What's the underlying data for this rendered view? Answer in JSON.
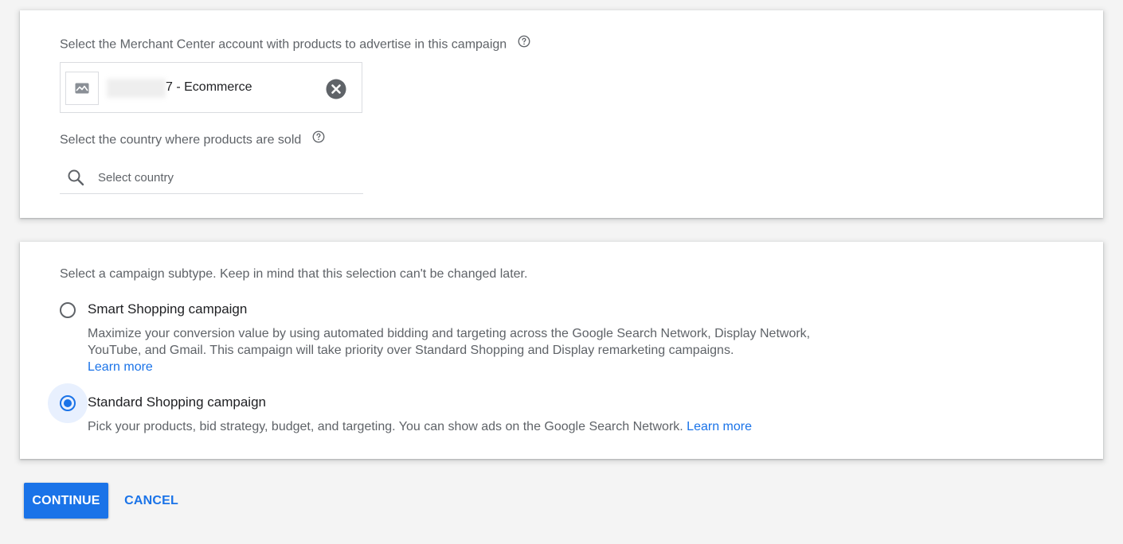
{
  "account_section": {
    "label": "Select the Merchant Center account with products to advertise in this campaign",
    "help_icon": "help-circle-icon",
    "selected_account": {
      "name": "7 - Ecommerce",
      "thumbnail_icon": "image-placeholder-icon",
      "clear_icon": "clear-circle-icon"
    },
    "country_label": "Select the country where products are sold",
    "country_help_icon": "help-circle-icon",
    "country_placeholder": "Select country",
    "country_value": "",
    "search_icon": "search-icon"
  },
  "subtype_section": {
    "label": "Select a campaign subtype. Keep in mind that this selection can't be changed later.",
    "options": [
      {
        "title": "Smart Shopping campaign",
        "description": "Maximize your conversion value by using automated bidding and targeting across the Google Search Network, Display Network, YouTube, and Gmail. This campaign will take priority over Standard Shopping and Display remarketing campaigns.",
        "link": "Learn more",
        "selected": false
      },
      {
        "title": "Standard Shopping campaign",
        "description": "Pick your products, bid strategy, budget, and targeting. You can show ads on the Google Search Network.",
        "link": "Learn more",
        "selected": true
      }
    ]
  },
  "actions": {
    "continue_label": "CONTINUE",
    "cancel_label": "CANCEL"
  },
  "colors": {
    "accent": "#1a73e8",
    "text_primary": "#202124",
    "text_secondary": "#5f6368",
    "background": "#f4f4f4"
  }
}
